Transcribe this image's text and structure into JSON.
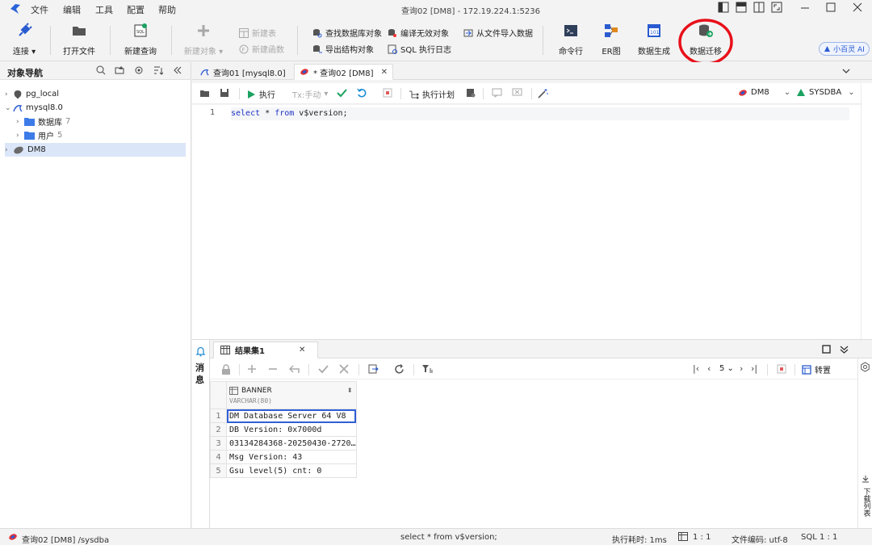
{
  "titlebar": {
    "menus": [
      "文件",
      "编辑",
      "工具",
      "配置",
      "帮助"
    ],
    "title": "查询02 [DM8] - 172.19.224.1:5236"
  },
  "ribbon": {
    "connect": "连接",
    "open_file": "打开文件",
    "new_query": "新建查询",
    "new_object": "新建对象",
    "new_table": "新建表",
    "new_function": "新建函数",
    "find_object": "查找数据库对象",
    "export_struct": "导出结构对象",
    "compile_invalid": "编译无效对象",
    "sql_log": "SQL 执行日志",
    "import_file": "从文件导入数据",
    "cmd": "命令行",
    "er": "ER图",
    "data_gen": "数据生成",
    "data_migrate": "数据迁移",
    "ai": "小百灵 AI"
  },
  "nav": {
    "title": "对象导航",
    "items": [
      {
        "label": "pg_local",
        "count": ""
      },
      {
        "label": "mysql8.0",
        "count": ""
      },
      {
        "label": "数据库",
        "count": "7"
      },
      {
        "label": "用户",
        "count": "5"
      },
      {
        "label": "DM8",
        "count": ""
      }
    ]
  },
  "tabs": [
    {
      "label": "查询01 [mysql8.0]"
    },
    {
      "label": "* 查询02 [DM8]"
    }
  ],
  "editor_toolbar": {
    "run": "执行",
    "tx": "Tx:手动",
    "plan": "执行计划",
    "db": "DM8",
    "user": "SYSDBA"
  },
  "editor": {
    "line_no": "1",
    "kw1": "select",
    "mid": " * ",
    "kw2": "from",
    "rest": " v$version;"
  },
  "result": {
    "side_label_1": "消",
    "side_label_2": "息",
    "tab": "结果集1",
    "page": "5",
    "transpose": "转置",
    "col_name": "BANNER",
    "col_type": "VARCHAR(80)",
    "rows": [
      {
        "n": "1",
        "v": "DM Database Server 64 V8"
      },
      {
        "n": "2",
        "v": "DB Version: 0x7000d"
      },
      {
        "n": "3",
        "v": "03134284368-20250430-2720…"
      },
      {
        "n": "4",
        "v": "Msg Version: 43"
      },
      {
        "n": "5",
        "v": "Gsu level(5) cnt: 0"
      }
    ],
    "download_list": "下载列表"
  },
  "status": {
    "left": "查询02 [DM8] /sysdba",
    "sql": "select * from v$version;",
    "exec_time": "执行耗时: 1ms",
    "pos": "1 : 1",
    "encoding": "文件编码: utf-8",
    "sql_pos": "SQL 1 : 1"
  },
  "colors": {
    "accent": "#2f5fd6",
    "highlight_circle": "#e8101a",
    "run_green": "#1aa260"
  }
}
